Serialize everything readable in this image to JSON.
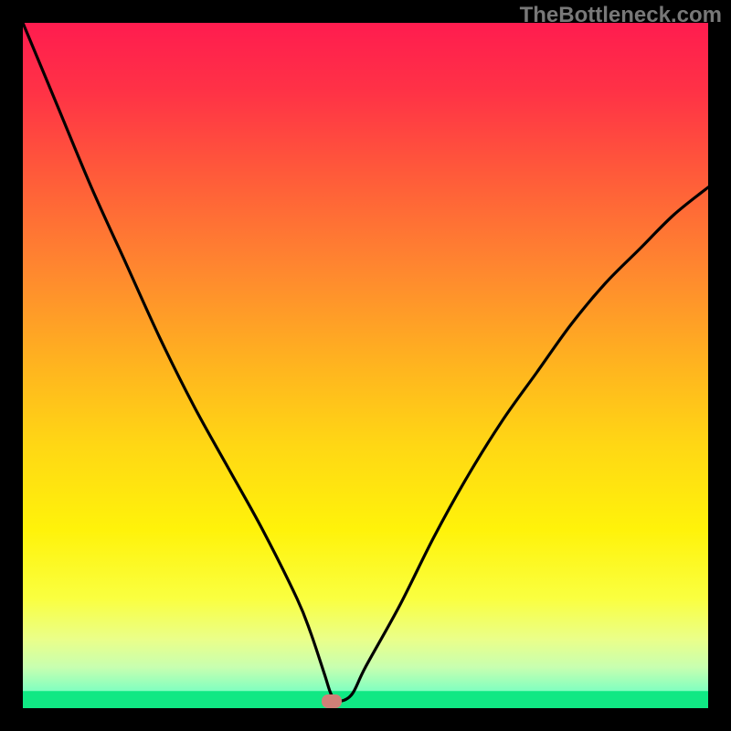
{
  "watermark": "TheBottleneck.com",
  "chart_data": {
    "type": "line",
    "title": "",
    "xlabel": "",
    "ylabel": "",
    "xlim": [
      0,
      100
    ],
    "ylim": [
      0,
      100
    ],
    "series": [
      {
        "name": "curve",
        "x": [
          0,
          5,
          10,
          15,
          20,
          25,
          30,
          35,
          40,
          42,
          44,
          45,
          46,
          48,
          50,
          55,
          60,
          65,
          70,
          75,
          80,
          85,
          90,
          95,
          100
        ],
        "values": [
          100,
          88,
          76,
          65,
          54,
          44,
          35,
          26,
          16,
          11,
          5,
          2,
          1,
          2,
          6,
          15,
          25,
          34,
          42,
          49,
          56,
          62,
          67,
          72,
          76
        ]
      }
    ],
    "marker": {
      "x": 45,
      "y": 1
    },
    "green_band": {
      "y_bottom": 0,
      "y_top": 2.5
    },
    "gradient_stops": [
      {
        "offset": 0,
        "color": "#ff1c4f"
      },
      {
        "offset": 10,
        "color": "#ff3246"
      },
      {
        "offset": 22,
        "color": "#ff5a3a"
      },
      {
        "offset": 35,
        "color": "#ff8430"
      },
      {
        "offset": 50,
        "color": "#ffb41f"
      },
      {
        "offset": 62,
        "color": "#ffd814"
      },
      {
        "offset": 74,
        "color": "#fff30a"
      },
      {
        "offset": 84,
        "color": "#faff40"
      },
      {
        "offset": 90,
        "color": "#eaff8a"
      },
      {
        "offset": 94,
        "color": "#c8ffb0"
      },
      {
        "offset": 97.5,
        "color": "#80ffc0"
      },
      {
        "offset": 100,
        "color": "#10e884"
      }
    ]
  }
}
